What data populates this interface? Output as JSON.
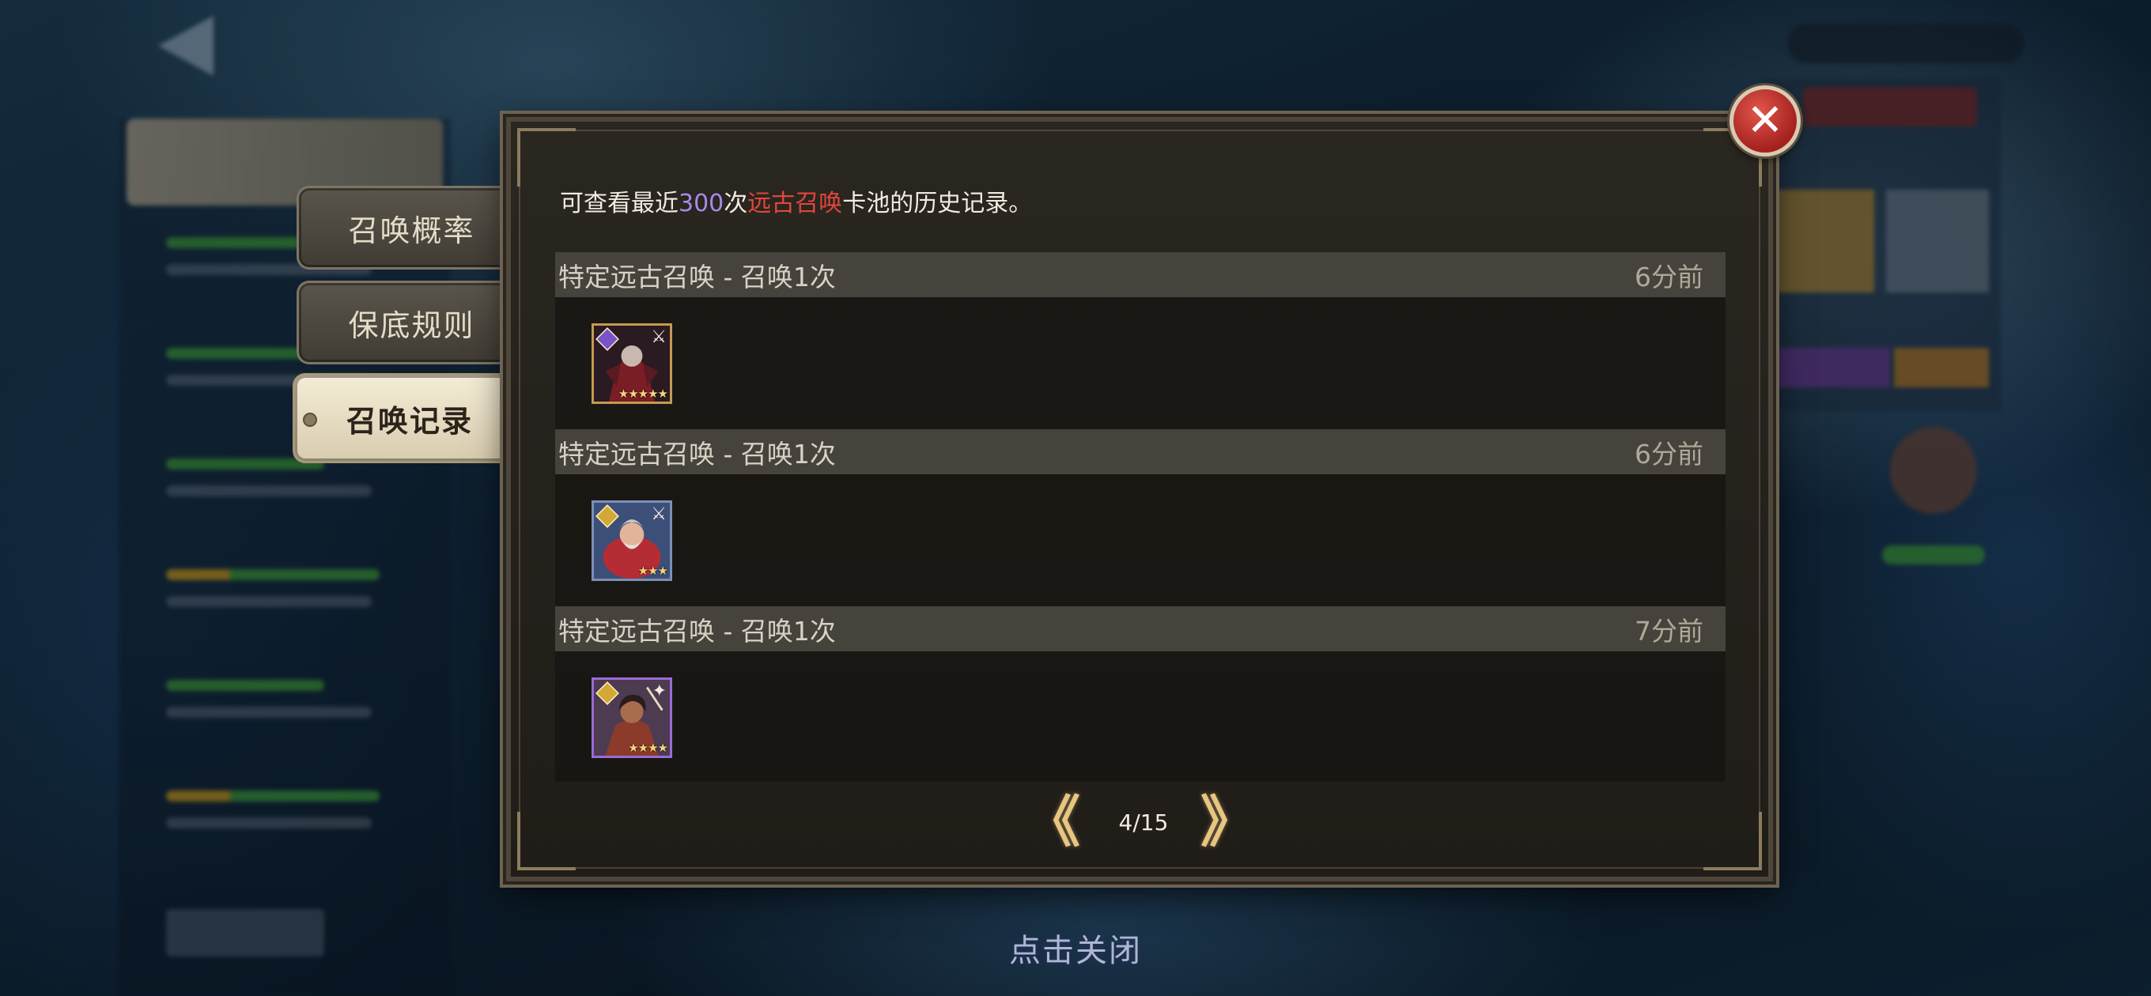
{
  "side_tabs": [
    {
      "label": "召唤概率",
      "active": false
    },
    {
      "label": "保底规则",
      "active": false
    },
    {
      "label": "召唤记录",
      "active": true
    }
  ],
  "dialog": {
    "info_prefix": "可查看最近",
    "info_count": "300",
    "info_middle": "次",
    "info_pool": "远古召唤",
    "info_suffix": "卡池的历史记录。"
  },
  "records": [
    {
      "title": "特定远古召唤 - 召唤1次",
      "time": "6分前",
      "hero": {
        "stars": "★★★★★",
        "frame": "gold",
        "type": "violet-diamond-icon",
        "weapon": "blade-icon"
      }
    },
    {
      "title": "特定远古召唤 - 召唤1次",
      "time": "6分前",
      "hero": {
        "stars": "★★★",
        "frame": "blue",
        "type": "gold-diamond-icon",
        "weapon": "blade-icon"
      }
    },
    {
      "title": "特定远古召唤 - 召唤1次",
      "time": "7分前",
      "hero": {
        "stars": "★★★★",
        "frame": "purple",
        "type": "gold-diamond-icon",
        "weapon": "wand-icon"
      }
    }
  ],
  "pagination": {
    "prev": "《",
    "text": "4/15",
    "next": "》"
  },
  "close_button": "✕",
  "close_hint": "点击关闭",
  "colors": {
    "count_highlight": "#a889e8",
    "pool_highlight": "#e2463c",
    "accent_gold": "#e8c581",
    "close_red": "#c0302a"
  }
}
